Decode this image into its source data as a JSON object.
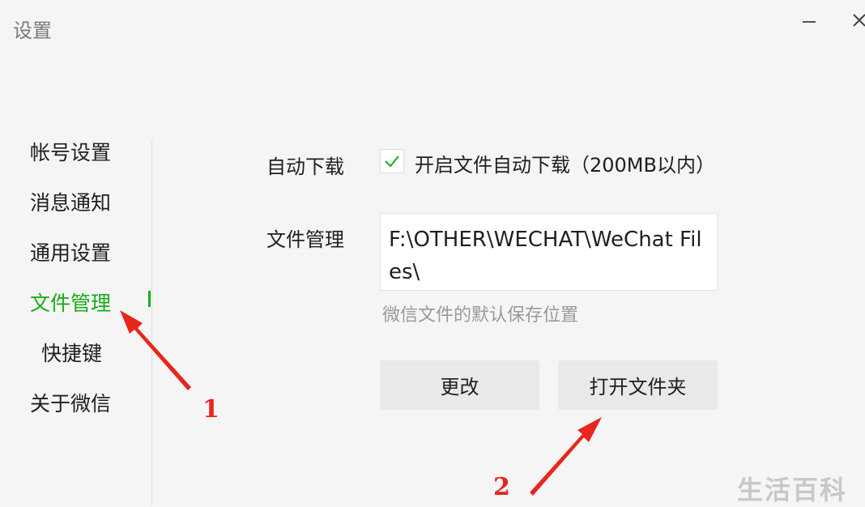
{
  "window": {
    "title": "设置",
    "minimize_label": "—",
    "close_label": "×"
  },
  "sidebar": {
    "items": [
      {
        "label": "帐号设置",
        "active": false
      },
      {
        "label": "消息通知",
        "active": false
      },
      {
        "label": "通用设置",
        "active": false
      },
      {
        "label": "文件管理",
        "active": true
      },
      {
        "label": "快捷键",
        "active": false
      },
      {
        "label": "关于微信",
        "active": false
      }
    ]
  },
  "main": {
    "auto_download": {
      "label": "自动下载",
      "checked": true,
      "checkbox_text": "开启文件自动下载（200MB以内）"
    },
    "file_management": {
      "label": "文件管理",
      "path": "F:\\OTHER\\WECHAT\\WeChat Files\\",
      "hint": "微信文件的默认保存位置"
    },
    "buttons": {
      "change": "更改",
      "open_folder": "打开文件夹"
    }
  },
  "annotations": {
    "arrow_1_label": "1",
    "arrow_2_label": "2",
    "color": "#e8261d"
  },
  "watermark": "生活百科",
  "colors": {
    "accent": "#1aad19",
    "background": "#f5f5f5",
    "button": "#e9e9e9"
  }
}
